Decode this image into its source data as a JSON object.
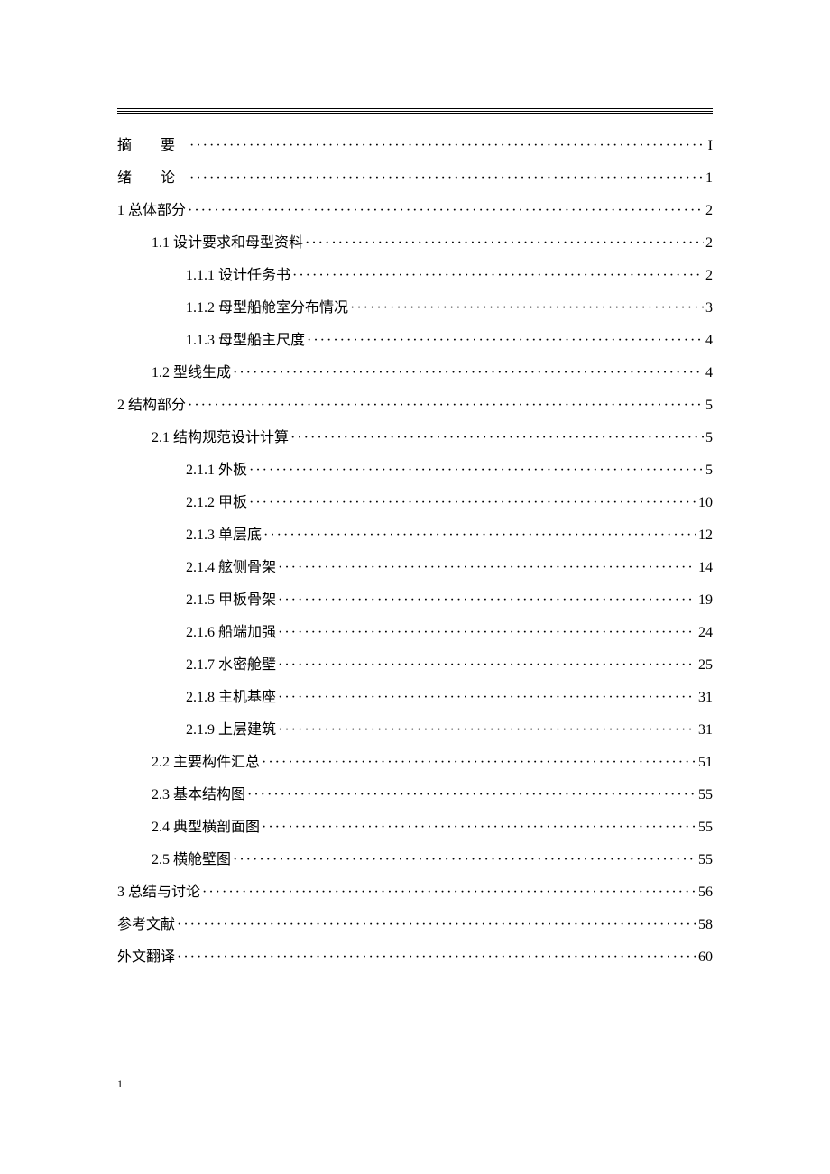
{
  "toc": [
    {
      "level": 0,
      "label": "摘  要",
      "page": "I",
      "spaced": true
    },
    {
      "level": 0,
      "label": "绪  论",
      "page": "1",
      "spaced": true
    },
    {
      "level": 0,
      "label": "1  总体部分",
      "page": "2"
    },
    {
      "level": 1,
      "label": "1.1  设计要求和母型资料",
      "page": "2"
    },
    {
      "level": 2,
      "label": "1.1.1  设计任务书",
      "page": "2"
    },
    {
      "level": 2,
      "label": "1.1.2  母型船舱室分布情况",
      "page": "3"
    },
    {
      "level": 2,
      "label": "1.1.3  母型船主尺度",
      "page": "4"
    },
    {
      "level": 1,
      "label": "1.2  型线生成",
      "page": "4"
    },
    {
      "level": 0,
      "label": "2  结构部分",
      "page": "5"
    },
    {
      "level": 1,
      "label": "2.1  结构规范设计计算",
      "page": "5"
    },
    {
      "level": 2,
      "label": "2.1.1  外板",
      "page": "5"
    },
    {
      "level": 2,
      "label": "2.1.2  甲板",
      "page": "10"
    },
    {
      "level": 2,
      "label": "2.1.3  单层底",
      "page": "12"
    },
    {
      "level": 2,
      "label": "2.1.4  舷侧骨架",
      "page": "14"
    },
    {
      "level": 2,
      "label": "2.1.5  甲板骨架",
      "page": "19"
    },
    {
      "level": 2,
      "label": "2.1.6  船端加强",
      "page": "24"
    },
    {
      "level": 2,
      "label": "2.1.7  水密舱壁",
      "page": "25"
    },
    {
      "level": 2,
      "label": "2.1.8  主机基座",
      "page": "31"
    },
    {
      "level": 2,
      "label": "2.1.9  上层建筑",
      "page": "31"
    },
    {
      "level": 1,
      "label": "2.2  主要构件汇总",
      "page": "51"
    },
    {
      "level": 1,
      "label": "2.3  基本结构图",
      "page": "55"
    },
    {
      "level": 1,
      "label": "2.4  典型横剖面图",
      "page": "55"
    },
    {
      "level": 1,
      "label": "2.5  横舱壁图",
      "page": "55"
    },
    {
      "level": 0,
      "label": "3  总结与讨论",
      "page": "56"
    },
    {
      "level": 0,
      "label": "参考文献",
      "page": "58"
    },
    {
      "level": 0,
      "label": "外文翻译",
      "page": "60"
    }
  ],
  "footer": {
    "page_number": "1"
  }
}
